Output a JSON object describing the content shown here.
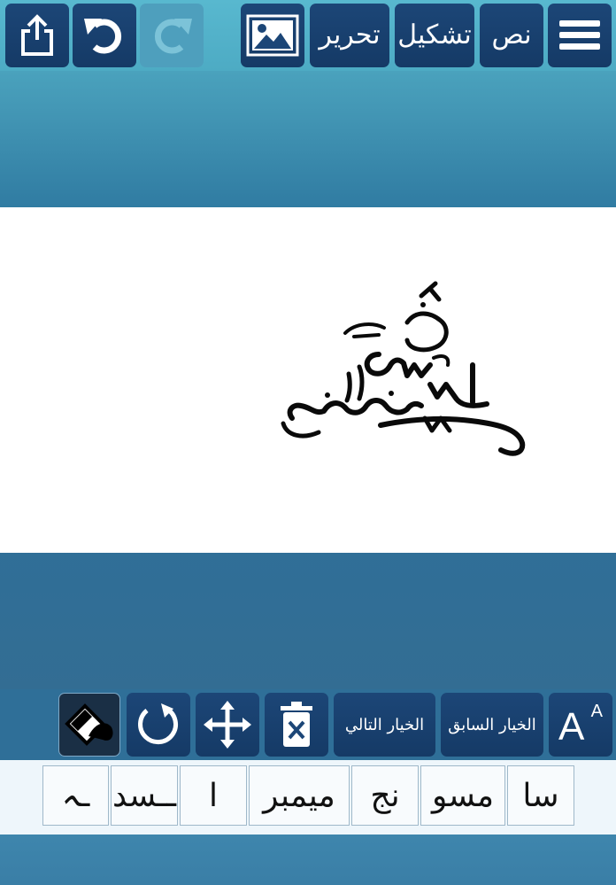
{
  "toolbar": {
    "menu_label": "",
    "text_label": "نص",
    "tashkeel_label": "تشكيل",
    "edit_label": "تحرير",
    "image_label": ""
  },
  "action_bar": {
    "font_size_label": "A",
    "font_size_super": "A",
    "prev_option_label": "الخيار السابق",
    "next_option_label": "الخيار التالي"
  },
  "segments": [
    {
      "text": "سا"
    },
    {
      "text": "مسو"
    },
    {
      "text": "نج"
    },
    {
      "text": "ميمبر"
    },
    {
      "text": "ا"
    },
    {
      "text": "ــسد"
    },
    {
      "text": "ـہ"
    }
  ],
  "colors": {
    "button_bg": "#1c4677",
    "disabled_bg": "#4e9fbd",
    "canvas_bg": "#ffffff",
    "strip_bg": "#eef6fb"
  }
}
